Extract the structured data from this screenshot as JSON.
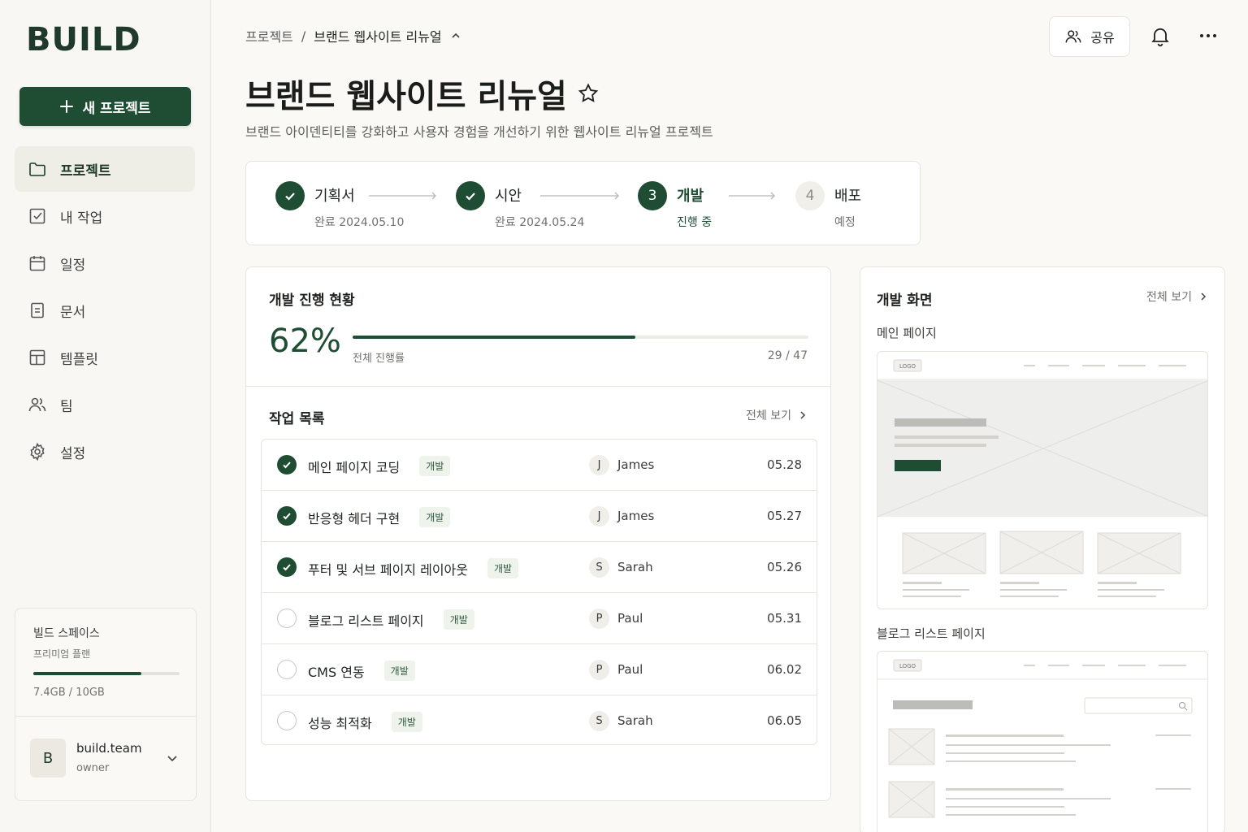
{
  "brand": "BUILD",
  "new_project_label": "새 프로젝트",
  "nav": [
    {
      "label": "프로젝트",
      "icon": "folder-icon",
      "active": true
    },
    {
      "label": "내 작업",
      "icon": "checkbox-icon",
      "active": false
    },
    {
      "label": "일정",
      "icon": "calendar-icon",
      "active": false
    },
    {
      "label": "문서",
      "icon": "document-icon",
      "active": false
    },
    {
      "label": "템플릿",
      "icon": "template-icon",
      "active": false
    },
    {
      "label": "팀",
      "icon": "team-icon",
      "active": false
    },
    {
      "label": "설정",
      "icon": "gear-icon",
      "active": false
    }
  ],
  "workspace": {
    "name": "빌드 스페이스",
    "plan": "프리미엄 플랜",
    "usage": "7.4GB / 10GB",
    "usage_fraction": 0.74,
    "team_initial": "B",
    "team_name": "build.team",
    "team_role": "owner"
  },
  "breadcrumb": {
    "root": "프로젝트",
    "separator": "/",
    "current": "브랜드 웹사이트 리뉴얼"
  },
  "header": {
    "share_label": "공유"
  },
  "project": {
    "title": "브랜드 웹사이트 리뉴얼",
    "description": "브랜드 아이덴티티를 강화하고 사용자 경험을 개선하기 위한 웹사이트 리뉴얼 프로젝트"
  },
  "steps": [
    {
      "label": "기획서",
      "sub": "완료 2024.05.10",
      "state": "done",
      "number": ""
    },
    {
      "label": "시안",
      "sub": "완료 2024.05.24",
      "state": "done",
      "number": ""
    },
    {
      "label": "개발",
      "sub": "진행 중",
      "state": "current",
      "number": "3"
    },
    {
      "label": "배포",
      "sub": "예정",
      "state": "pending",
      "number": "4"
    }
  ],
  "progress": {
    "title": "개발 진행 현황",
    "percent_label": "62%",
    "fraction": 0.62,
    "bar_label": "전체 진행률",
    "count": "29 / 47"
  },
  "tasks": {
    "title": "작업 목록",
    "view_all": "전체 보기",
    "rows": [
      {
        "title": "메인 페이지 코딩",
        "tag": "개발",
        "initial": "J",
        "assignee": "James",
        "date": "05.28",
        "done": true
      },
      {
        "title": "반응형 헤더 구현",
        "tag": "개발",
        "initial": "J",
        "assignee": "James",
        "date": "05.27",
        "done": true
      },
      {
        "title": "푸터 및 서브 페이지 레이아웃",
        "tag": "개발",
        "initial": "S",
        "assignee": "Sarah",
        "date": "05.26",
        "done": true
      },
      {
        "title": "블로그 리스트 페이지",
        "tag": "개발",
        "initial": "P",
        "assignee": "Paul",
        "date": "05.31",
        "done": false
      },
      {
        "title": "CMS 연동",
        "tag": "개발",
        "initial": "P",
        "assignee": "Paul",
        "date": "06.02",
        "done": false
      },
      {
        "title": "성능 최적화",
        "tag": "개발",
        "initial": "S",
        "assignee": "Sarah",
        "date": "06.05",
        "done": false
      }
    ]
  },
  "screens": {
    "title": "개발 화면",
    "view_all": "전체 보기",
    "main_label": "메인 페이지",
    "blog_label": "블로그 리스트 페이지",
    "logo_text": "LOGO"
  },
  "colors": {
    "accent": "#1e4d33",
    "background": "#faf9f6",
    "border": "#e6e4de"
  }
}
